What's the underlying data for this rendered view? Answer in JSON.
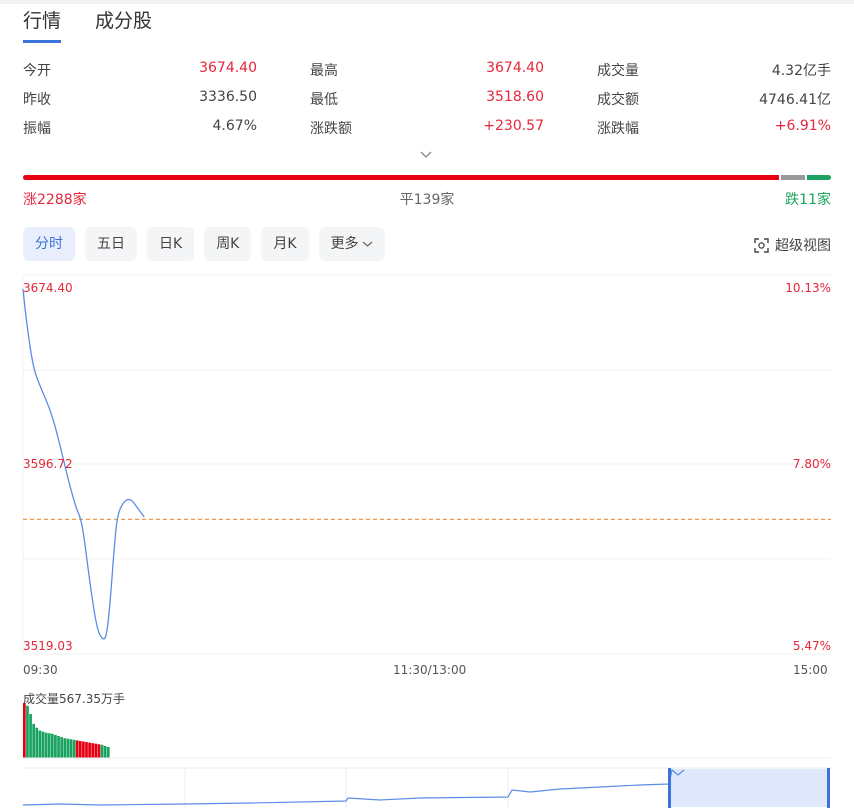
{
  "tabs": [
    {
      "label": "行情",
      "active": true
    },
    {
      "label": "成分股",
      "active": false
    }
  ],
  "stats": [
    [
      {
        "label": "今开",
        "value": "3674.40",
        "color": "red"
      },
      {
        "label": "最高",
        "value": "3674.40",
        "color": "red"
      },
      {
        "label": "成交量",
        "value": "4.32亿手",
        "color": "dark"
      }
    ],
    [
      {
        "label": "昨收",
        "value": "3336.50",
        "color": "dark"
      },
      {
        "label": "最低",
        "value": "3518.60",
        "color": "red"
      },
      {
        "label": "成交额",
        "value": "4746.41亿",
        "color": "dark"
      }
    ],
    [
      {
        "label": "振幅",
        "value": "4.67%",
        "color": "dark"
      },
      {
        "label": "涨跌额",
        "value": "+230.57",
        "color": "red"
      },
      {
        "label": "涨跌幅",
        "value": "+6.91%",
        "color": "red"
      }
    ]
  ],
  "breadth": {
    "up_label": "涨2288家",
    "flat_label": "平139家",
    "down_label": "跌11家",
    "up_count": 2288,
    "flat_count": 139,
    "down_count": 11
  },
  "period_tabs": [
    {
      "label": "分时",
      "active": true
    },
    {
      "label": "五日",
      "active": false
    },
    {
      "label": "日K",
      "active": false
    },
    {
      "label": "周K",
      "active": false
    },
    {
      "label": "月K",
      "active": false
    },
    {
      "label": "更多",
      "active": false,
      "dropdown": true
    }
  ],
  "super_view_label": "超级视图",
  "colors": {
    "up": "#e60012",
    "down": "#1aa260",
    "line": "#5b8ce6",
    "prev_close": "#f2994a",
    "accent": "#3b73d9"
  },
  "chart_data": {
    "type": "line",
    "y_left_ticks": [
      "3674.40",
      "3596.72",
      "3519.03"
    ],
    "y_right_ticks": [
      "10.13%",
      "7.80%",
      "5.47%"
    ],
    "x_ticks": [
      "09:30",
      "11:30/13:00",
      "15:00"
    ],
    "ylim": [
      3519.03,
      3674.4
    ],
    "prev_close_value": 3574,
    "total_minutes": 240,
    "series": [
      {
        "x": [
          0,
          1,
          3,
          5,
          8,
          10,
          12,
          14,
          16,
          17,
          18,
          20,
          22,
          24,
          25,
          26,
          27,
          28,
          30,
          32,
          34,
          35,
          36
        ],
        "values": [
          3674,
          3660,
          3640,
          3632,
          3622,
          3612,
          3600,
          3588,
          3578,
          3575,
          3568,
          3545,
          3526,
          3521,
          3525,
          3540,
          3560,
          3576,
          3582,
          3583,
          3579,
          3577,
          3575
        ]
      }
    ],
    "volume_label": "成交量567.35万手",
    "volume": {
      "values": [
        100,
        95,
        80,
        62,
        55,
        50,
        48,
        46,
        45,
        44,
        42,
        40,
        38,
        36,
        35,
        34,
        33,
        32,
        31,
        30,
        29,
        28,
        27,
        26,
        25,
        24,
        22,
        20
      ],
      "colors": [
        "up",
        "down",
        "down",
        "down",
        "down",
        "down",
        "down",
        "down",
        "down",
        "down",
        "down",
        "down",
        "down",
        "down",
        "down",
        "down",
        "down",
        "up",
        "up",
        "up",
        "up",
        "up",
        "up",
        "up",
        "up",
        "down",
        "down",
        "down"
      ]
    }
  }
}
